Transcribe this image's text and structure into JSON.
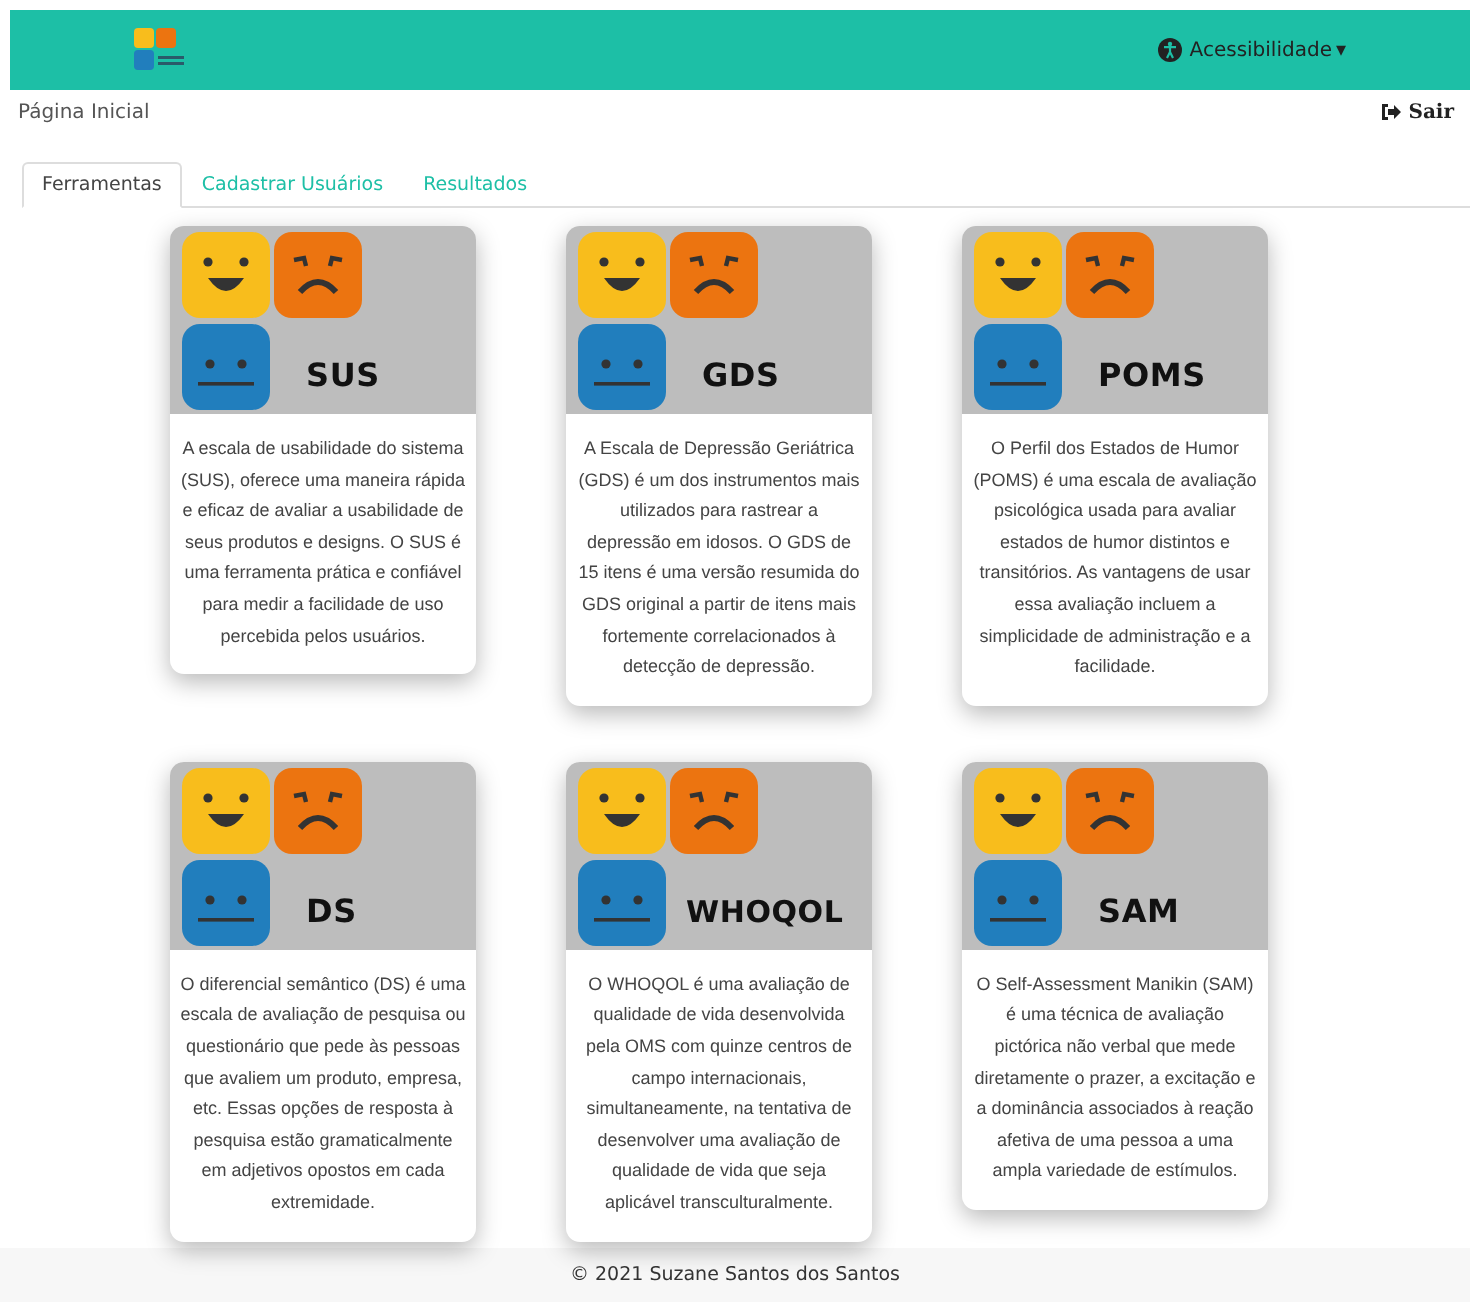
{
  "navbar": {
    "accessibility": "Acessibilidade",
    "caret": "▾"
  },
  "breadcrumb": "Página Inicial",
  "logout": "Sair",
  "tabs": [
    {
      "label": "Ferramentas",
      "selected": true
    },
    {
      "label": "Cadastrar Usuários",
      "selected": false
    },
    {
      "label": "Resultados",
      "selected": false
    }
  ],
  "cards": [
    {
      "title": "SUS",
      "description": "A escala de usabilidade do sistema (SUS), oferece uma maneira rápida e eficaz de avaliar a usabilidade de seus produtos e designs. O SUS é uma ferramenta prática e confiável para medir a facilidade de uso percebida pelos usuários."
    },
    {
      "title": "GDS",
      "description": "A Escala de Depressão Geriátrica (GDS) é um dos instrumentos mais utilizados para rastrear a depressão em idosos. O GDS de 15 itens é uma versão resumida do GDS original a partir de itens mais fortemente correlacionados à detecção de depressão."
    },
    {
      "title": "POMS",
      "description": "O Perfil dos Estados de Humor (POMS) é uma escala de avaliação psicológica usada para avaliar estados de humor distintos e transitórios. As vantagens de usar essa avaliação incluem a simplicidade de administração e a facilidade."
    },
    {
      "title": "DS",
      "description": "O diferencial semântico (DS) é uma escala de avaliação de pesquisa ou questionário que pede às pessoas que avaliem um produto, empresa, etc. Essas opções de resposta à pesquisa estão gramaticalmente em adjetivos opostos em cada extremidade."
    },
    {
      "title": "WHOQOL",
      "description": "O WHOQOL é uma avaliação de qualidade de vida desenvolvida pela OMS com quinze centros de campo internacionais, simultaneamente, na tentativa de desenvolver uma avaliação de qualidade de vida que seja aplicável transculturalmente."
    },
    {
      "title": "SAM",
      "description": "O Self-Assessment Manikin (SAM) é uma técnica de avaliação pictórica não verbal que mede diretamente o prazer, a excitação e a dominância associados à reação afetiva de uma pessoa a uma ampla variedade de estímulos."
    }
  ],
  "footer": "© 2021 Suzane Santos dos Santos"
}
